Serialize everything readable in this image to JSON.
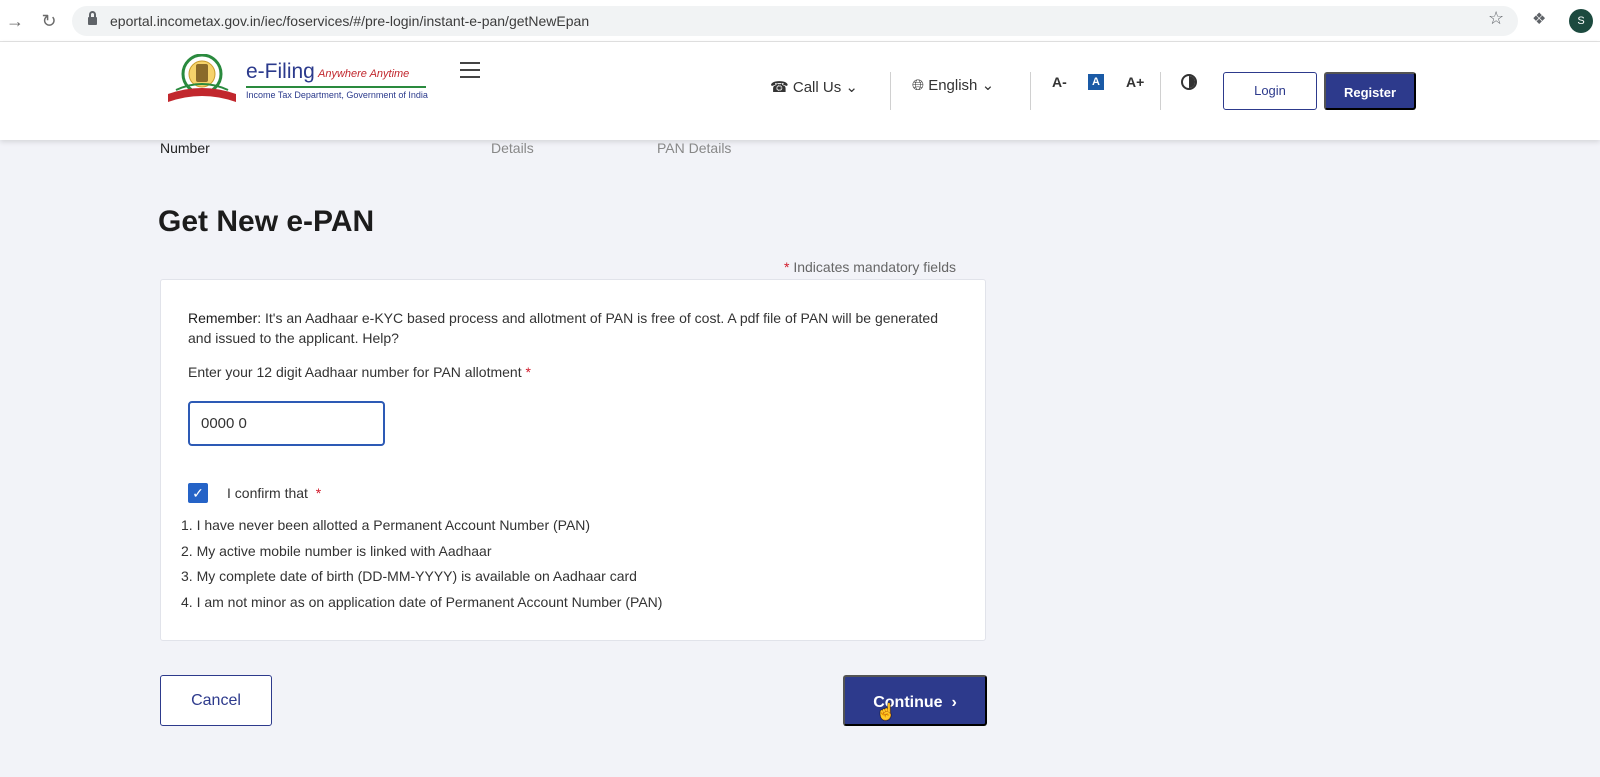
{
  "browser": {
    "url": "eportal.incometax.gov.in/iec/foservices/#/pre-login/instant-e-pan/getNewEpan",
    "back_icon": "→",
    "reload_icon": "C",
    "profile_initial": "S"
  },
  "header": {
    "brand_title": "e-Filing",
    "brand_tagline": "Anywhere Anytime",
    "brand_subtitle": "Income Tax Department, Government of India",
    "call_us": "Call Us",
    "language": "English",
    "font_decrease": "A-",
    "font_normal": "A",
    "font_increase": "A+",
    "login": "Login",
    "register": "Register"
  },
  "stepper": {
    "step1": "Number",
    "step2": "Details",
    "step3": "PAN Details"
  },
  "page": {
    "title": "Get New e-PAN",
    "mandatory_note": "Indicates mandatory fields"
  },
  "form": {
    "remember_label": "Remember:",
    "remember_text": "It's an Aadhaar e-KYC based process and allotment of PAN is free of cost. A pdf file of PAN will be generated and issued to the applicant. Help?",
    "aadhaar_label": "Enter your 12 digit Aadhaar number for PAN allotment",
    "aadhaar_value": "0000 0",
    "confirm_label": "I confirm that",
    "conditions": [
      "1. I have never been allotted a Permanent Account Number (PAN)",
      "2. My active mobile number is linked with Aadhaar",
      "3. My complete date of birth (DD-MM-YYYY) is available on Aadhaar card",
      "4. I am not minor as on application date of Permanent Account Number (PAN)"
    ],
    "cancel": "Cancel",
    "continue": "Continue"
  },
  "colors": {
    "primary": "#2d3a8c",
    "required": "#d11a2a",
    "page_bg": "#f2f3f8"
  }
}
